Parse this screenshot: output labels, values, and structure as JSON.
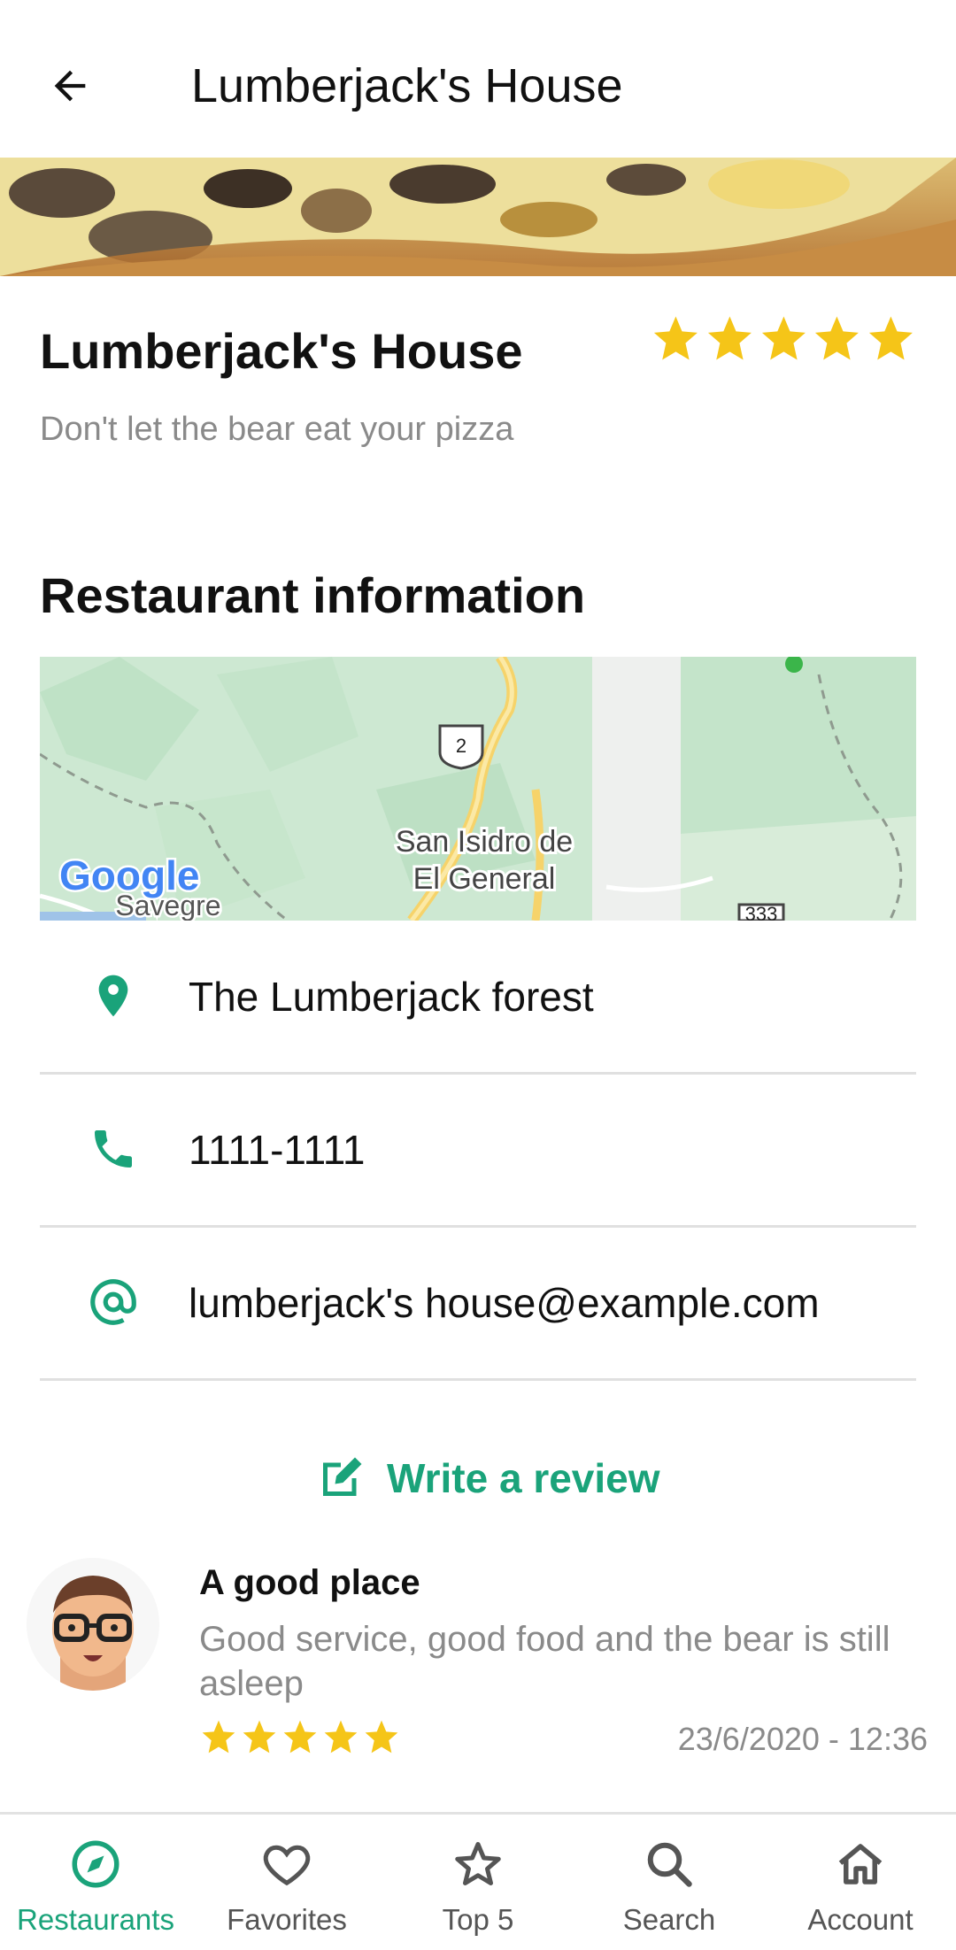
{
  "appbar": {
    "title": "Lumberjack's House",
    "back_icon": "arrow-back-icon"
  },
  "restaurant": {
    "name": "Lumberjack's House",
    "slogan": "Don't let the bear eat your pizza",
    "rating": 5,
    "rating_max": 5
  },
  "info": {
    "section_title": "Restaurant information",
    "map": {
      "city": "San Isidro de",
      "city_line2": "El General",
      "place": "Savegre",
      "route_1": "2",
      "route_2": "333",
      "logo": "Google"
    },
    "address": "The Lumberjack forest",
    "phone": "1111-1111",
    "email": "lumberjack's house@example.com"
  },
  "write_review": {
    "label": "Write a review",
    "icon": "edit-icon"
  },
  "reviews": [
    {
      "title": "A good place",
      "text": "Good service, good food and the bear is still asleep",
      "rating": 5,
      "date": "23/6/2020 - 12:36"
    }
  ],
  "nav": {
    "items": [
      {
        "label": "Restaurants",
        "icon": "compass-icon",
        "active": true
      },
      {
        "label": "Favorites",
        "icon": "heart-icon"
      },
      {
        "label": "Top 5",
        "icon": "star-icon"
      },
      {
        "label": "Search",
        "icon": "search-icon"
      },
      {
        "label": "Account",
        "icon": "home-icon"
      }
    ]
  },
  "colors": {
    "accent": "#1aa37a",
    "star": "#f5c518",
    "muted": "#8a8a8a"
  }
}
